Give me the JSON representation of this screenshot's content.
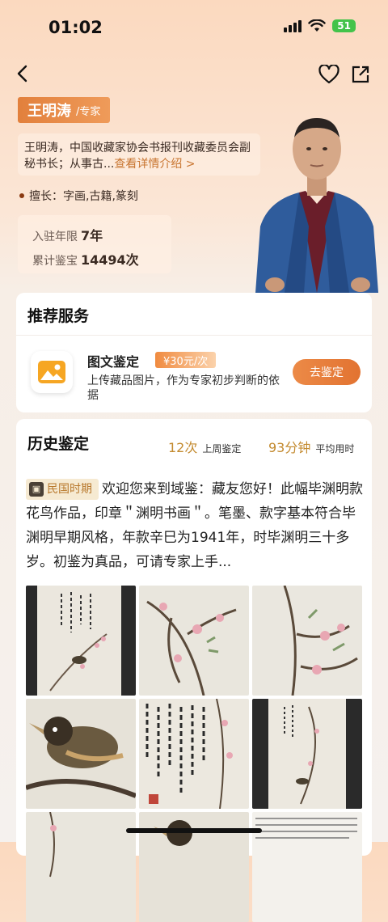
{
  "status_bar": {
    "time": "01:02",
    "battery": "51"
  },
  "expert": {
    "name": "王明涛",
    "title": "/专家",
    "bio": "王明涛，中国收藏家协会书报刊收藏委员会副秘书长；从事古...",
    "bio_more": "查看详情介绍 >",
    "specialty": "擅长：字画,古籍,篆刻",
    "years_label": "入驻年限",
    "years_value": "7年",
    "appraisals_label": "累计鉴宝",
    "appraisals_value": "14494次"
  },
  "service": {
    "section_title": "推荐服务",
    "name": "图文鉴定",
    "price": "¥30元/次",
    "desc": "上传藏品图片，作为专家初步判断的依据",
    "button": "去鉴定"
  },
  "history": {
    "section_title": "历史鉴定",
    "last_week_value": "12次",
    "last_week_label": "上周鉴定",
    "avg_value": "93分钟",
    "avg_label": "平均用时",
    "era_tag": "民国时期",
    "text": "欢迎您来到域鉴：藏友您好！此幅毕渊明款花鸟作品，印章＂渊明书画＂。笔墨、款字基本符合毕渊明早期风格，年款辛巳为1941年，时毕渊明三十多岁。初鉴为真品，可请专家上手..."
  },
  "colors": {
    "accent": "#e27331",
    "gold": "#c38a2f",
    "badge": "#e2803c"
  }
}
